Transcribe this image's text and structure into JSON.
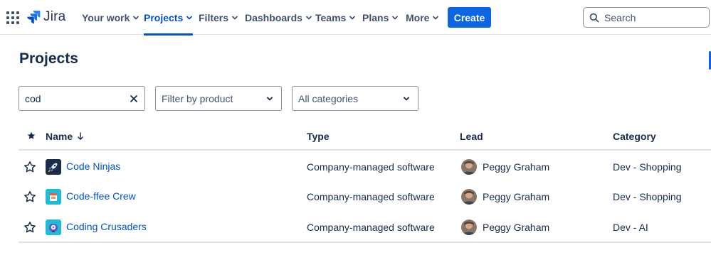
{
  "nav": {
    "logo_text": "Jira",
    "items": [
      {
        "label": "Your work"
      },
      {
        "label": "Projects"
      },
      {
        "label": "Filters"
      },
      {
        "label": "Dashboards"
      },
      {
        "label": "Teams"
      },
      {
        "label": "Plans"
      },
      {
        "label": "More"
      }
    ],
    "active_item": "Projects",
    "create_label": "Create",
    "search_placeholder": "Search"
  },
  "page": {
    "title": "Projects"
  },
  "filters": {
    "search_value": "cod",
    "product_placeholder": "Filter by product",
    "category_value": "All categories"
  },
  "table": {
    "columns": {
      "name": "Name",
      "type": "Type",
      "lead": "Lead",
      "category": "Category"
    },
    "sort_column": "Name",
    "rows": [
      {
        "name": "Code Ninjas",
        "type": "Company-managed software",
        "lead": "Peggy Graham",
        "category": "Dev - Shopping",
        "icon": "rocket-icon"
      },
      {
        "name": "Code-ffee Crew",
        "type": "Company-managed software",
        "lead": "Peggy Graham",
        "category": "Dev - Shopping",
        "icon": "coffee-icon"
      },
      {
        "name": "Coding Crusaders",
        "type": "Company-managed software",
        "lead": "Peggy Graham",
        "category": "Dev - AI",
        "icon": "robot-icon"
      }
    ]
  },
  "colors": {
    "accent": "#0c66e4",
    "link": "#0052cc",
    "text": "#172b4d",
    "subtle_text": "#42526e",
    "border": "#dfe1e6"
  }
}
